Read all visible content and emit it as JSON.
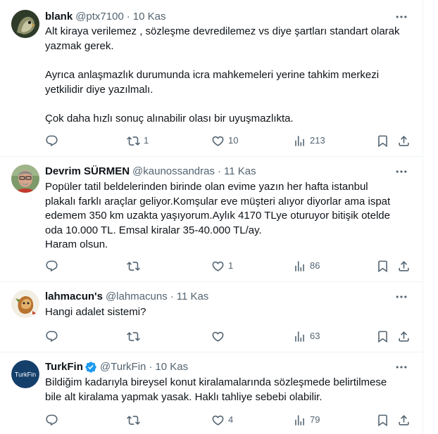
{
  "tweets": [
    {
      "name": "blank",
      "verified": false,
      "handle": "@ptx7100",
      "time": "10 Kas",
      "paragraphs": [
        "Alt kiraya verilemez , sözleşme devredilemez vs diye şartları standart olarak yazmak gerek.",
        "Ayrıca anlaşmazlık durumunda icra mahkemeleri yerine tahkim merkezi yetkilidir diye yazılmalı.",
        "Çok daha hızlı sonuç alınabilir olası bir uyuşmazlıkta."
      ],
      "reposts": "1",
      "likes": "10",
      "views": "213"
    },
    {
      "name": "Devrim SÜRMEN",
      "verified": false,
      "handle": "@kaunossandras",
      "time": "11 Kas",
      "lines": [
        "Popüler tatil beldelerinden birinde olan evime yazın her hafta istanbul",
        "plakalı farklı araçlar geliyor.Komşular eve müşteri alıyor diyorlar ama ispat",
        "edemem 350 km uzakta yaşıyorum.Aylık 4170 TLye oturuyor bitişik otelde",
        "oda 10.000 TL. Emsal kiralar 35-40.000 TL/ay.",
        "Haram olsun."
      ],
      "reposts": "",
      "likes": "1",
      "views": "86"
    },
    {
      "name": "lahmacun's",
      "verified": false,
      "handle": "@lahmacuns",
      "time": "11 Kas",
      "lines": [
        "Hangi adalet sistemi?"
      ],
      "reposts": "",
      "likes": "",
      "views": "63"
    },
    {
      "name": "TurkFin",
      "verified": true,
      "handle": "@TurkFin",
      "time": "10 Kas",
      "avatar_text": "TurkFin",
      "lines": [
        "Bildiğim kadarıyla bireysel konut kiralamalarında sözleşmede belirtilmese",
        "bile alt kiralama yapmak yasak. Haklı tahliye sebebi olabilir."
      ],
      "reposts": "",
      "likes": "4",
      "views": "79"
    }
  ],
  "separator": "·",
  "icons": {
    "reply": "reply-icon",
    "repost": "repost-icon",
    "like": "heart-icon",
    "views": "views-icon",
    "bookmark": "bookmark-icon",
    "share": "share-icon",
    "more": "more-icon",
    "verified": "verified-badge-icon"
  },
  "colors": {
    "text_primary": "#0f1419",
    "text_secondary": "#536471",
    "verified_blue": "#1d9bf0",
    "divider": "#eff3f4",
    "turkfin_avatar": "#143f6b"
  }
}
